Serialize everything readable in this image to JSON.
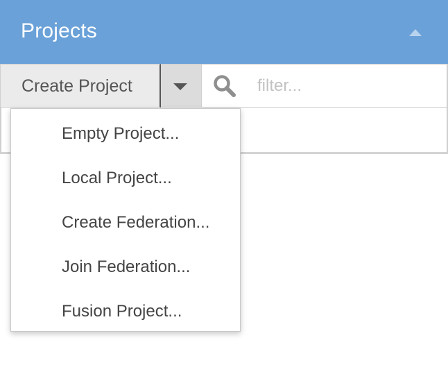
{
  "header": {
    "title": "Projects",
    "collapse_icon": "caret-up-icon"
  },
  "toolbar": {
    "create_label": "Create Project",
    "dropdown_icon": "caret-down-icon",
    "search_icon": "search-icon",
    "filter": {
      "value": "",
      "placeholder": "filter..."
    }
  },
  "menu": {
    "items": [
      {
        "label": "Empty Project..."
      },
      {
        "label": "Local Project..."
      },
      {
        "label": "Create Federation..."
      },
      {
        "label": "Join Federation..."
      },
      {
        "label": "Fusion Project..."
      }
    ]
  },
  "colors": {
    "header_bg": "#6aa1d8",
    "header_text": "#ffffff",
    "button_bg": "#ebebeb",
    "toggle_bg": "#dcdcdc",
    "text": "#555555"
  }
}
